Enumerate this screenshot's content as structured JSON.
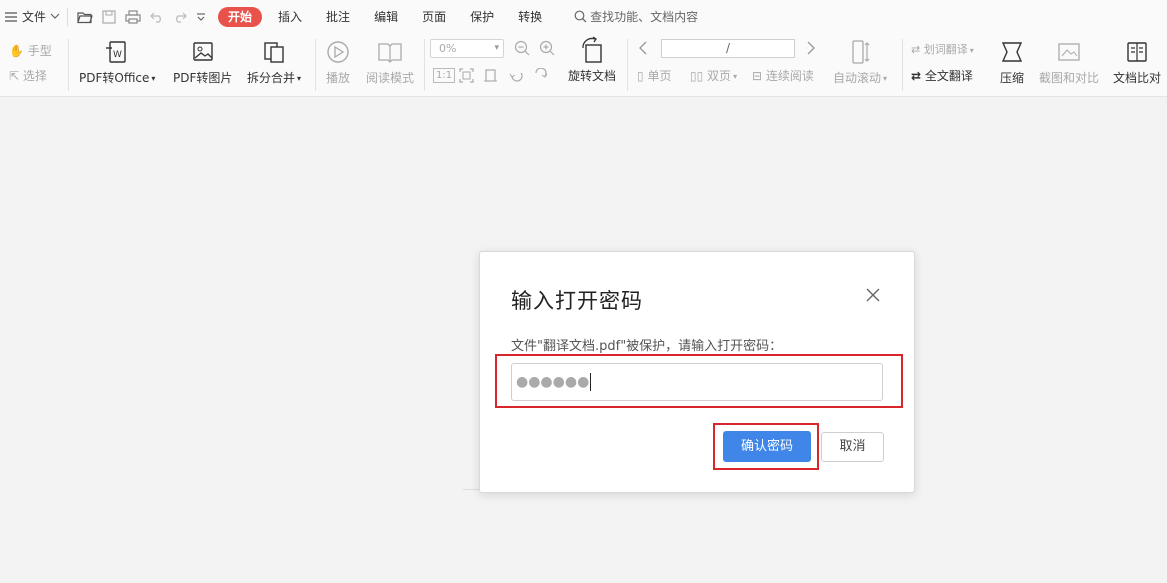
{
  "menu": {
    "file_label": "文件"
  },
  "tabs": [
    {
      "label": "开始"
    },
    {
      "label": "插入"
    },
    {
      "label": "批注"
    },
    {
      "label": "编辑"
    },
    {
      "label": "页面"
    },
    {
      "label": "保护"
    },
    {
      "label": "转换"
    }
  ],
  "search": {
    "placeholder": "查找功能、文档内容"
  },
  "ribbon": {
    "hand": "手型",
    "select": "选择",
    "pdf_to_office": "PDF转Office",
    "pdf_to_image": "PDF转图片",
    "split_merge": "拆分合并",
    "play": "播放",
    "read_mode": "阅读模式",
    "zoom_value": "0%",
    "fit_label": "1:1",
    "rotate_doc": "旋转文档",
    "page_value": "/",
    "single_page": "单页",
    "double_page": "双页",
    "continuous": "连续阅读",
    "auto_scroll": "自动滚动",
    "word_translate": "划词翻译",
    "full_translate": "全文翻译",
    "compress": "压缩",
    "screenshot_compare": "截图和对比",
    "doc_compare": "文档比对"
  },
  "dialog": {
    "title": "输入打开密码",
    "message": "文件\"翻译文档.pdf\"被保护，请输入打开密码：",
    "password_masked": "●●●●●●",
    "confirm_label": "确认密码",
    "cancel_label": "取消"
  },
  "colors": {
    "accent_active_tab": "#e8524a",
    "primary_button": "#3f86e8",
    "highlight_frame": "#d9262c"
  }
}
